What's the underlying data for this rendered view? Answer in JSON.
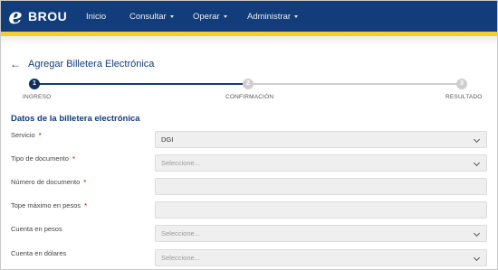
{
  "header": {
    "logo_letter": "e",
    "logo_text": "BROU",
    "nav": [
      {
        "label": "Inicio",
        "dropdown": false
      },
      {
        "label": "Consultar",
        "dropdown": true
      },
      {
        "label": "Operar",
        "dropdown": true
      },
      {
        "label": "Administrar",
        "dropdown": true
      }
    ],
    "colors": {
      "bar": "#123d7a",
      "accent": "#f2cf2e"
    }
  },
  "page": {
    "title": "Agregar Billetera Electrónica",
    "back_icon": "arrow-left-icon"
  },
  "stepper": {
    "steps": [
      {
        "number": "1",
        "label": "INGRESO",
        "state": "active"
      },
      {
        "number": "2",
        "label": "CONFIRMACIÓN",
        "state": "pending"
      },
      {
        "number": "3",
        "label": "RESULTADO",
        "state": "pending"
      }
    ]
  },
  "section": {
    "title": "Datos de la billetera electrónica"
  },
  "form": {
    "fields": [
      {
        "label": "Servicio",
        "required": true,
        "type": "select",
        "value": "DGI",
        "placeholder": ""
      },
      {
        "label": "Tipo de documento",
        "required": true,
        "type": "select",
        "value": "",
        "placeholder": "Seleccione..."
      },
      {
        "label": "Número de documento",
        "required": true,
        "type": "text",
        "value": "",
        "placeholder": ""
      },
      {
        "label": "Tope máximo en pesos",
        "required": true,
        "type": "text",
        "value": "",
        "placeholder": ""
      },
      {
        "label": "Cuenta en pesos",
        "required": false,
        "type": "select",
        "value": "",
        "placeholder": "Seleccione..."
      },
      {
        "label": "Cuenta en dólares",
        "required": false,
        "type": "select",
        "value": "",
        "placeholder": "Seleccione..."
      }
    ],
    "required_mark": "*"
  }
}
